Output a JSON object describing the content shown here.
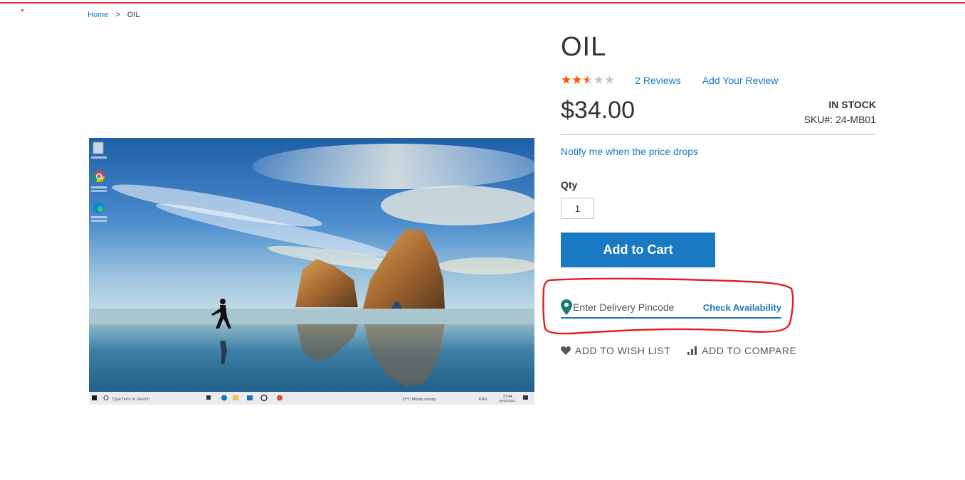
{
  "breadcrumb": {
    "home": "Home",
    "separator": ">",
    "current": "OIL"
  },
  "product": {
    "title": "OIL",
    "rating_percent": 50,
    "stars_glyphs": "★★★★★",
    "reviews_link": "2  Reviews",
    "add_review_link": "Add Your Review",
    "price": "$34.00",
    "stock": "IN STOCK",
    "sku_label": "SKU#:",
    "sku_value": "24-MB01",
    "notify_link": "Notify me when the price drops",
    "qty_label": "Qty",
    "qty_value": "1",
    "add_to_cart": "Add to Cart"
  },
  "delivery": {
    "placeholder": "Enter Delivery Pincode",
    "check_label": "Check Availability",
    "icon": "map-pin-icon"
  },
  "actions": {
    "wishlist": "ADD TO WISH LIST",
    "compare": "ADD TO COMPARE"
  },
  "colors": {
    "accent": "#1979c3",
    "star": "#ff5501",
    "annotation": "#e02020",
    "pin": "#1a7a6e"
  },
  "media_image": {
    "description_icons": [
      "recycle-bin-icon",
      "chrome-icon",
      "edge-icon"
    ],
    "taskbar_search": "Type here to search",
    "taskbar_weather": "21°C  Mostly cloudy",
    "taskbar_lang": "ENG",
    "taskbar_time": "21:44",
    "taskbar_date": "19-03-2023"
  }
}
